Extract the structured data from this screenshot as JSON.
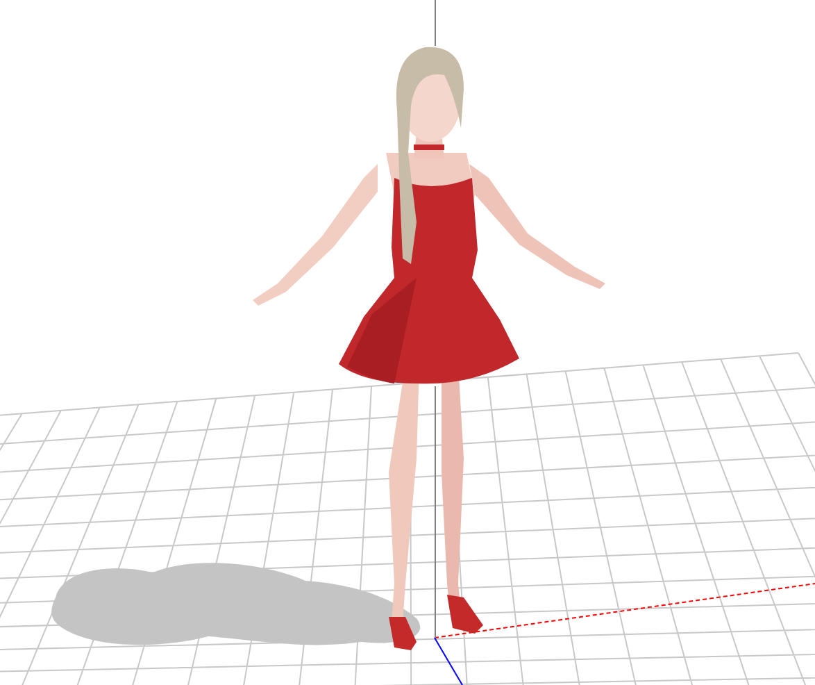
{
  "viewport": {
    "show_grid": true,
    "show_shadow": true,
    "axes": [
      {
        "kind": "x",
        "color": "#ff0000"
      },
      {
        "kind": "y",
        "color": "#7f7f7f"
      },
      {
        "kind": "z",
        "color": "#0000ff"
      }
    ]
  }
}
